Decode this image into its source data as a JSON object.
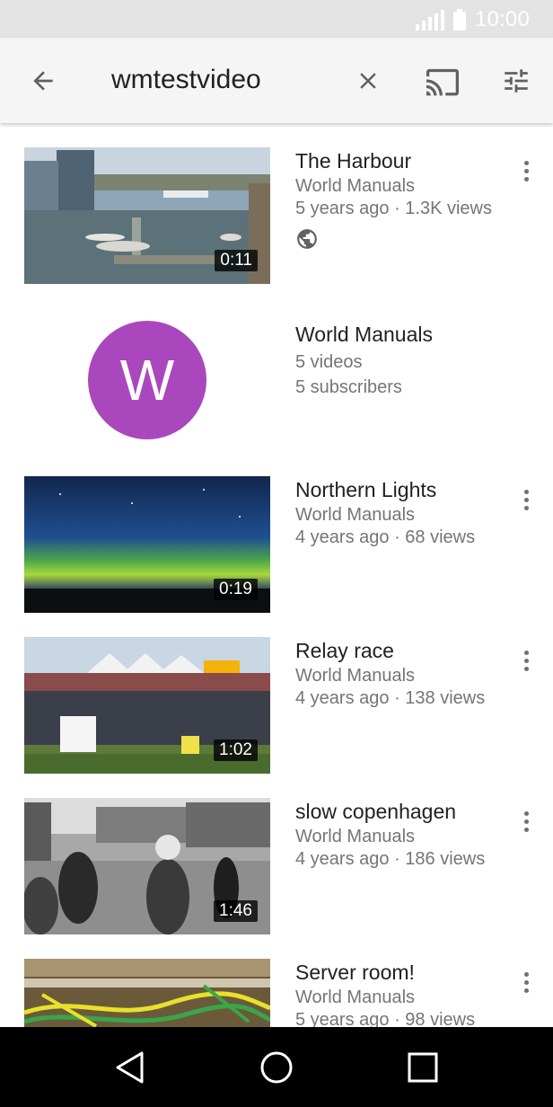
{
  "status_bar": {
    "time": "10:00",
    "signal_icon": "signal-icon",
    "battery_icon": "battery-icon"
  },
  "toolbar": {
    "back_icon": "arrow-back-icon",
    "query": "wmtestvideo",
    "clear_icon": "close-icon",
    "cast_icon": "cast-icon",
    "filter_icon": "tune-icon"
  },
  "results": [
    {
      "type": "video",
      "title": "The Harbour",
      "channel": "World Manuals",
      "stats": "5 years ago · 1.3K views",
      "duration": "0:11",
      "public_icon": "globe-icon"
    },
    {
      "type": "channel",
      "avatar_letter": "W",
      "name": "World Manuals",
      "videos": "5 videos",
      "subscribers": "5 subscribers",
      "avatar_color": "#ab47bc"
    },
    {
      "type": "video",
      "title": "Northern Lights",
      "channel": "World Manuals",
      "stats": "4 years ago · 68 views",
      "duration": "0:19"
    },
    {
      "type": "video",
      "title": "Relay race",
      "channel": "World Manuals",
      "stats": "4 years ago · 138 views",
      "duration": "1:02"
    },
    {
      "type": "video",
      "title": "slow copenhagen",
      "channel": "World Manuals",
      "stats": "4 years ago · 186 views",
      "duration": "1:46"
    },
    {
      "type": "video",
      "title": "Server room!",
      "channel": "World Manuals",
      "stats": "5 years ago · 98 views"
    }
  ],
  "nav_bar": {
    "back_icon": "nav-back-icon",
    "home_icon": "nav-home-icon",
    "recents_icon": "nav-recents-icon"
  }
}
